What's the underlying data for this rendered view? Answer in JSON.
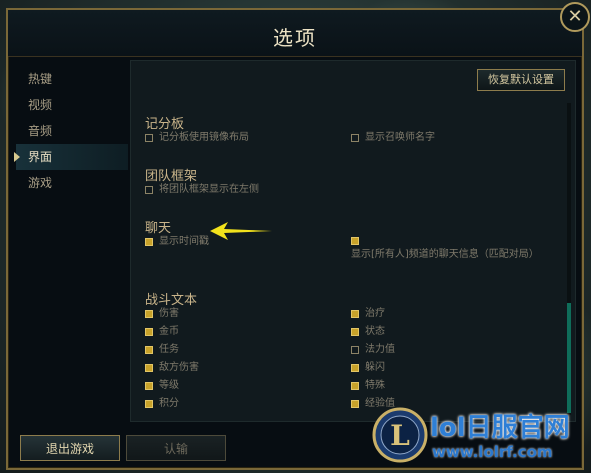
{
  "window": {
    "title": "选项"
  },
  "sidebar": {
    "items": [
      {
        "label": "热键"
      },
      {
        "label": "视频"
      },
      {
        "label": "音频"
      },
      {
        "label": "界面"
      },
      {
        "label": "游戏"
      }
    ]
  },
  "buttons": {
    "reset": "恢复默认设置",
    "exit": "退出游戏",
    "confirm": "认输"
  },
  "sections": {
    "scoreboard": {
      "title": "记分板",
      "options": [
        {
          "label": "记分板使用镜像布局",
          "checked": false
        },
        {
          "label": "显示召唤师名字",
          "checked": false
        }
      ]
    },
    "team_frames": {
      "title": "团队框架",
      "options": [
        {
          "label": "将团队框架显示在左侧",
          "checked": false
        }
      ]
    },
    "chat": {
      "title": "聊天",
      "options": [
        {
          "label": "显示时间戳",
          "checked": true
        },
        {
          "label": "显示[所有人]频道的聊天信息（匹配对局）",
          "checked": true
        }
      ]
    },
    "combat_text": {
      "title": "战斗文本",
      "options": [
        {
          "label": "伤害",
          "checked": true
        },
        {
          "label": "治疗",
          "checked": true
        },
        {
          "label": "金币",
          "checked": true
        },
        {
          "label": "状态",
          "checked": true
        },
        {
          "label": "任务",
          "checked": true
        },
        {
          "label": "法力值",
          "checked": false
        },
        {
          "label": "敌方伤害",
          "checked": true
        },
        {
          "label": "躲闪",
          "checked": true
        },
        {
          "label": "等级",
          "checked": true
        },
        {
          "label": "特殊",
          "checked": true
        },
        {
          "label": "积分",
          "checked": true
        },
        {
          "label": "经验值",
          "checked": true
        }
      ]
    }
  },
  "watermark": {
    "brand": "lol日服官网",
    "url": "www.lolrf.com",
    "logo_letter": "L"
  },
  "colors": {
    "gold": "#c8a22a",
    "accent": "#0f6d5a",
    "watermark": "#2e7fd6"
  },
  "icons": {
    "close": "close-icon",
    "arrow": "arrow-left-icon"
  }
}
